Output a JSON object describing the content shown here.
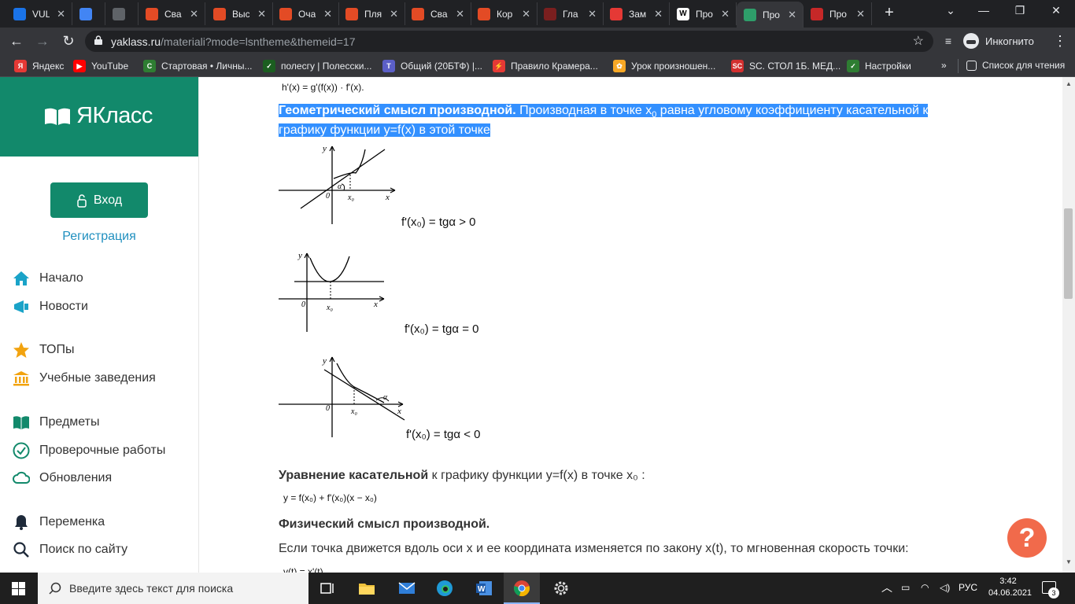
{
  "browser": {
    "tabs": [
      {
        "title": "VUL",
        "favicon_color": "#1a73e8"
      },
      {
        "title": "",
        "favicon_color": "#4285f4"
      },
      {
        "title": "",
        "favicon_color": "#5f6368"
      },
      {
        "title": "Сва",
        "favicon_color": "#e34b25"
      },
      {
        "title": "Выс",
        "favicon_color": "#e34b25"
      },
      {
        "title": "Оча",
        "favicon_color": "#e34b25"
      },
      {
        "title": "Пля",
        "favicon_color": "#e34b25"
      },
      {
        "title": "Сва",
        "favicon_color": "#e34b25"
      },
      {
        "title": "Кор",
        "favicon_color": "#e34b25"
      },
      {
        "title": "Гла",
        "favicon_color": "#7a1f1f"
      },
      {
        "title": "Зам",
        "favicon_color": "#e53935"
      },
      {
        "title": "Про",
        "favicon_color": "#ffffff"
      },
      {
        "title": "Про",
        "favicon_color": "#2e9e6a"
      },
      {
        "title": "Про",
        "favicon_color": "#c62828"
      }
    ],
    "active_tab_index": 12,
    "url_host": "yaklass.ru",
    "url_path": "/materiali?mode=lsntheme&themeid=17",
    "incognito_label": "Инкогнито",
    "bookmarks": [
      {
        "label": "Яндекс",
        "icon_color": "#e53935",
        "icon_char": "Я"
      },
      {
        "label": "YouTube",
        "icon_color": "#ff0000",
        "icon_char": "▶"
      },
      {
        "label": "Стартовая • Личны...",
        "icon_color": "#2e7d32",
        "icon_char": "C"
      },
      {
        "label": "полесгу | Полесски...",
        "icon_color": "#1b5e20",
        "icon_char": "✓"
      },
      {
        "label": "Общий (20БТФ) |...",
        "icon_color": "#5b5fc7",
        "icon_char": "T"
      },
      {
        "label": "Правило Крамера...",
        "icon_color": "#e53935",
        "icon_char": "⚡"
      },
      {
        "label": "Урок произношен...",
        "icon_color": "#f9a825",
        "icon_char": "✿"
      },
      {
        "label": "SC. СТОЛ 1Б. МЕД...",
        "icon_color": "#d32f2f",
        "icon_char": "SC"
      },
      {
        "label": "Настройки",
        "icon_color": "#2e7d32",
        "icon_char": "✓"
      }
    ],
    "overflow_label": "»",
    "reading_list_label": "Список для чтения"
  },
  "sidebar": {
    "logo_text": "ЯКласс",
    "logo_color": "#12896b",
    "login_label": "Вход",
    "register_label": "Регистрация",
    "items": [
      {
        "label": "Начало",
        "icon": "home-icon"
      },
      {
        "label": "Новости",
        "icon": "news-icon"
      },
      {
        "label": "ТОПы",
        "icon": "star-icon"
      },
      {
        "label": "Учебные заведения",
        "icon": "institution-icon"
      },
      {
        "label": "Предметы",
        "icon": "book-icon"
      },
      {
        "label": "Проверочные работы",
        "icon": "check-icon"
      },
      {
        "label": "Обновления",
        "icon": "cloud-icon"
      },
      {
        "label": "Переменка",
        "icon": "bell-icon"
      },
      {
        "label": "Поиск по сайту",
        "icon": "search-icon"
      }
    ]
  },
  "content": {
    "top_formula": "h'(x) = g'(f(x)) · f'(x).",
    "geom_title": "Геометрический смысл производной.",
    "geom_text_1": " Производная в точке x",
    "geom_sub": "0",
    "geom_text_2": " равна угловому коэффициенту касательной к",
    "geom_text_3": "графику функции  y=f(x) в этой точке",
    "graph1_formula": "f'(x₀) = tgα > 0",
    "graph2_formula": "f'(x₀) = tgα = 0",
    "graph3_formula": "f'(x₀) = tgα < 0",
    "graph_labels": {
      "x": "x",
      "y": "y",
      "zero": "0",
      "x0": "x₀",
      "alpha": "α"
    },
    "tangent_title": "Уравнение касательной",
    "tangent_text": " к графику функции y=f(x) в точке x₀ :",
    "tangent_formula": "y = f(x₀) + f'(x₀)(x − x₀)",
    "physics_title": "Физический смысл производной.",
    "physics_text": "Если точка движется вдоль оси x и ее координата изменяется по закону  x(t), то мгновенная скорость точки:",
    "physics_formula_partial": "v(t) = x'(t)"
  },
  "taskbar": {
    "search_placeholder": "Введите здесь текст для поиска",
    "language": "РУС",
    "time": "3:42",
    "date": "04.06.2021",
    "notifications": "3"
  }
}
